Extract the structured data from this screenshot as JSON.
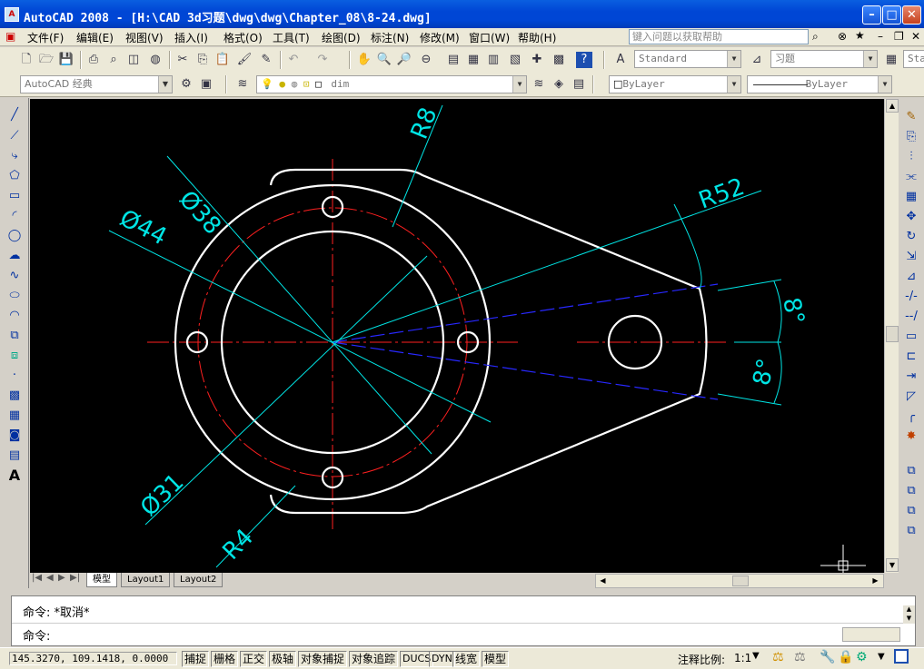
{
  "titlebar": {
    "title": "AutoCAD 2008 - [H:\\CAD  3d习题\\dwg\\dwg\\Chapter_08\\8-24.dwg]",
    "icon_text": "A"
  },
  "menu": {
    "items": [
      "文件(F)",
      "编辑(E)",
      "视图(V)",
      "插入(I)",
      "格式(O)",
      "工具(T)",
      "绘图(D)",
      "标注(N)",
      "修改(M)",
      "窗口(W)",
      "帮助(H)"
    ]
  },
  "help": {
    "placeholder": "键入问题以获取帮助"
  },
  "toolbar": {
    "text_style": "Standard",
    "dim_style": "习题",
    "table_style": "Sta",
    "workspace": "AutoCAD 经典",
    "layer": "dim",
    "color": "ByLayer",
    "linetype": "ByLayer"
  },
  "drawing": {
    "dims": {
      "d38": "Ø38",
      "d44": "Ø44",
      "d31": "Ø31",
      "r8": "R8",
      "r52": "R52",
      "r4": "R4",
      "a1": "8°",
      "a2": "8°"
    },
    "colors": {
      "object": "#ffffff",
      "center": "#ff0000",
      "dim": "#00e5e5",
      "hidden": "#2020ff",
      "background": "#000000"
    }
  },
  "layout_tabs": [
    "模型",
    "Layout1",
    "Layout2"
  ],
  "command": {
    "line1": "命令: *取消*",
    "line2": "命令:"
  },
  "status": {
    "coords": "145.3270, 109.1418, 0.0000",
    "buttons": [
      "捕捉",
      "栅格",
      "正交",
      "极轴",
      "对象捕捉",
      "对象追踪",
      "DUCS",
      "DYN",
      "线宽",
      "模型"
    ],
    "annotation_scale_label": "注释比例:",
    "annotation_scale": "1:1"
  }
}
